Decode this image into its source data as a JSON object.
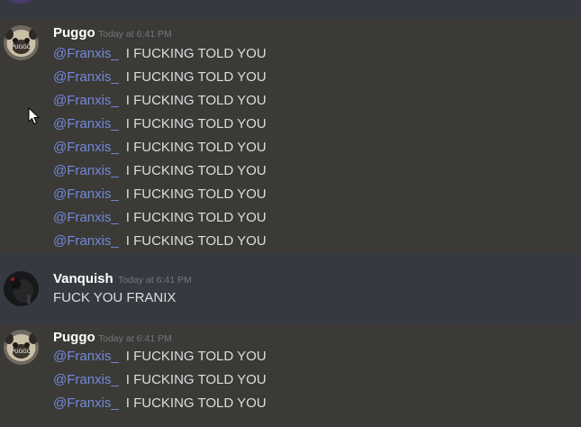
{
  "messages": [
    {
      "username": "Puggo",
      "timestamp": "Today at 6:41 PM",
      "lines": [
        {
          "mention": "@Franxis_",
          "text": "I FUCKING TOLD YOU"
        },
        {
          "mention": "@Franxis_",
          "text": "I FUCKING TOLD YOU"
        },
        {
          "mention": "@Franxis_",
          "text": "I FUCKING TOLD YOU"
        },
        {
          "mention": "@Franxis_",
          "text": "I FUCKING TOLD YOU"
        },
        {
          "mention": "@Franxis_",
          "text": "I FUCKING TOLD YOU"
        },
        {
          "mention": "@Franxis_",
          "text": "I FUCKING TOLD YOU"
        },
        {
          "mention": "@Franxis_",
          "text": "I FUCKING TOLD YOU"
        },
        {
          "mention": "@Franxis_",
          "text": "I FUCKING TOLD YOU"
        },
        {
          "mention": "@Franxis_",
          "text": "I FUCKING TOLD YOU"
        }
      ]
    },
    {
      "username": "Vanquish",
      "timestamp": "Today at 6:41 PM",
      "lines": [
        {
          "mention": "",
          "text": "FUCK YOU FRANIX"
        }
      ]
    },
    {
      "username": "Puggo",
      "timestamp": "Today at 6:41 PM",
      "lines": [
        {
          "mention": "@Franxis_",
          "text": "I FUCKING TOLD YOU"
        },
        {
          "mention": "@Franxis_",
          "text": "I FUCKING TOLD YOU"
        },
        {
          "mention": "@Franxis_",
          "text": "I FUCKING TOLD YOU"
        }
      ]
    }
  ],
  "avatars": {
    "puggo_label": "PUGGO"
  },
  "colors": {
    "background": "#36393f",
    "highlight_background": "#3b3a37",
    "mention": "#7289da",
    "username": "#ffffff",
    "text": "#dcddde",
    "timestamp": "#72767d"
  },
  "icons": [
    "pug-avatar",
    "dark-avatar",
    "mouse-cursor-icon"
  ]
}
